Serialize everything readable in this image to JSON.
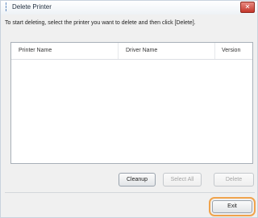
{
  "window": {
    "title": "Delete Printer",
    "close_glyph": "✕"
  },
  "instruction": "To start deleting, select the printer you want to delete and then click [Delete].",
  "list": {
    "columns": [
      "Printer Name",
      "Driver Name",
      "Version"
    ],
    "rows": []
  },
  "buttons": {
    "cleanup": "Cleanup",
    "select_all": "Select All",
    "delete": "Delete",
    "exit": "Exit"
  },
  "colors": {
    "highlight": "#f0a34c",
    "close_button": "#c4362b"
  },
  "icons": {
    "title": "printer-icon"
  }
}
